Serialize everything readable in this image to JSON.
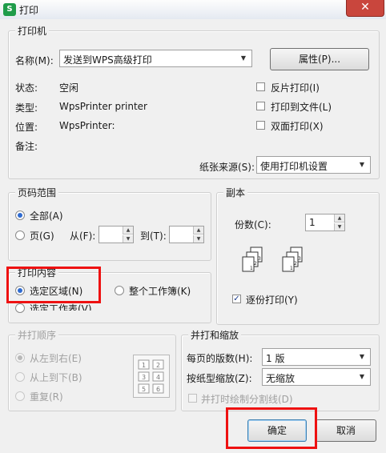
{
  "window": {
    "title": "打印",
    "app_icon": "S",
    "close_glyph": "✕"
  },
  "printer": {
    "group_title": "打印机",
    "name_label": "名称(M):",
    "name_value": "发送到WPS高级打印",
    "properties_button": "属性(P)...",
    "status_label": "状态:",
    "status_value": "空闲",
    "type_label": "类型:",
    "type_value": "WpsPrinter printer",
    "location_label": "位置:",
    "location_value": "WpsPrinter:",
    "comment_label": "备注:",
    "reverse_print": {
      "label": "反片打印(I)",
      "checked": false
    },
    "print_to_file": {
      "label": "打印到文件(L)",
      "checked": false
    },
    "duplex": {
      "label": "双面打印(X)",
      "checked": false
    },
    "paper_source_label": "纸张来源(S):",
    "paper_source_value": "使用打印机设置"
  },
  "page_range": {
    "group_title": "页码范围",
    "all_label": "全部(A)",
    "pages_label": "页(G)",
    "from_label": "从(F):",
    "to_label": "到(T):",
    "from_value": "",
    "to_value": ""
  },
  "copies": {
    "group_title": "副本",
    "count_label": "份数(C):",
    "count_value": "1",
    "collate": {
      "label": "逐份打印(Y)",
      "checked": true
    }
  },
  "print_content": {
    "group_title": "打印内容",
    "selection_label": "选定区域(N)",
    "workbook_label": "整个工作簿(K)",
    "sheet_label": "选定工作表(V)"
  },
  "print_order": {
    "group_title": "并打顺序",
    "left_to_right": "从左到右(E)",
    "top_to_bottom": "从上到下(B)",
    "repeat": "重复(R)",
    "grid": [
      "1",
      "2",
      "3",
      "4",
      "5",
      "6"
    ]
  },
  "scaling": {
    "group_title": "并打和缩放",
    "pages_per_sheet_label": "每页的版数(H):",
    "pages_per_sheet_value": "1 版",
    "paper_scale_label": "按纸型缩放(Z):",
    "paper_scale_value": "无缩放",
    "draw_dividers_label": "并打时绘制分割线(D)"
  },
  "buttons": {
    "ok": "确定",
    "cancel": "取消"
  },
  "colors": {
    "highlight_box": "#ee1111",
    "radio_dot": "#2f6bd0",
    "close_button": "#c9463d"
  }
}
